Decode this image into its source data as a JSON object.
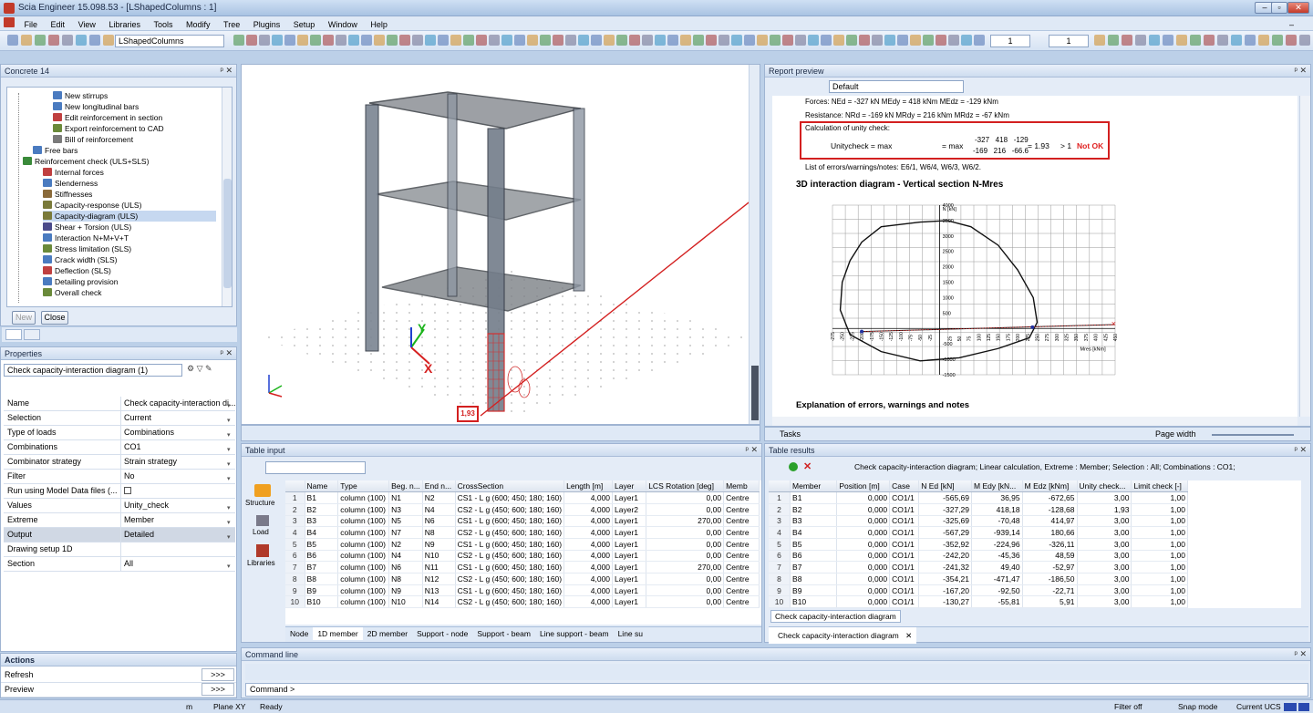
{
  "app": {
    "title": "Scia Engineer 15.098.53 - [LShapedColumns : 1]"
  },
  "menu": [
    "File",
    "Edit",
    "View",
    "Libraries",
    "Tools",
    "Modify",
    "Tree",
    "Plugins",
    "Setup",
    "Window",
    "Help"
  ],
  "toolbar": {
    "project_combo": "LShapedColumns",
    "spin1": "1",
    "spin2": "1"
  },
  "left_tree": {
    "title": "Concrete 14",
    "items": [
      {
        "label": "New stirrups",
        "indent": 4,
        "color": "#4a7bc0"
      },
      {
        "label": "New longitudinal bars",
        "indent": 4,
        "color": "#4a7bc0"
      },
      {
        "label": "Edit reinforcement in section",
        "indent": 4,
        "color": "#c04040"
      },
      {
        "label": "Export reinforcement to CAD",
        "indent": 4,
        "color": "#6a8a3a"
      },
      {
        "label": "Bill of reinforcement",
        "indent": 4,
        "color": "#7a7a7a"
      },
      {
        "label": "Free bars",
        "indent": 2,
        "color": "#4a7bc0"
      },
      {
        "label": "Reinforcement check (ULS+SLS)",
        "indent": 1,
        "color": "#3a8a3a"
      },
      {
        "label": "Internal forces",
        "indent": 3,
        "color": "#c04040"
      },
      {
        "label": "Slenderness",
        "indent": 3,
        "color": "#4a7bc0"
      },
      {
        "label": "Stiffnesses",
        "indent": 3,
        "color": "#8a6a3a"
      },
      {
        "label": "Capacity-response (ULS)",
        "indent": 3,
        "color": "#7a7a3a"
      },
      {
        "label": "Capacity-diagram (ULS)",
        "indent": 3,
        "color": "#7a7a3a",
        "selected": true
      },
      {
        "label": "Shear + Torsion (ULS)",
        "indent": 3,
        "color": "#4a4a8a"
      },
      {
        "label": "Interaction N+M+V+T",
        "indent": 3,
        "color": "#4a7bc0"
      },
      {
        "label": "Stress limitation (SLS)",
        "indent": 3,
        "color": "#6a8a3a"
      },
      {
        "label": "Crack width (SLS)",
        "indent": 3,
        "color": "#4a7bc0"
      },
      {
        "label": "Deflection (SLS)",
        "indent": 3,
        "color": "#c04040"
      },
      {
        "label": "Detailing provision",
        "indent": 3,
        "color": "#4a7bc0"
      },
      {
        "label": "Overall check",
        "indent": 3,
        "color": "#6a8a3a"
      }
    ],
    "new_btn": "New",
    "close_btn": "Close"
  },
  "properties": {
    "title": "Properties",
    "selector": "Check capacity-interaction diagram (1)",
    "rows": [
      {
        "k": "Name",
        "v": "Check capacity-interaction di..."
      },
      {
        "k": "Selection",
        "v": "Current"
      },
      {
        "k": "Type of loads",
        "v": "Combinations"
      },
      {
        "k": "Combinations",
        "v": "CO1"
      },
      {
        "k": "Combinator strategy",
        "v": "Strain strategy"
      },
      {
        "k": "Filter",
        "v": "No"
      },
      {
        "k": "Run using Model Data files (...",
        "v": ""
      },
      {
        "k": "Values",
        "v": "Unity_check"
      },
      {
        "k": "Extreme",
        "v": "Member"
      },
      {
        "k": "Output",
        "v": "Detailed"
      },
      {
        "k": "Drawing setup 1D",
        "v": ""
      },
      {
        "k": "Section",
        "v": "All"
      }
    ]
  },
  "actions": {
    "title": "Actions",
    "items": [
      {
        "label": "Refresh",
        "arrow": ">>>"
      },
      {
        "label": "Preview",
        "arrow": ">>>"
      }
    ]
  },
  "view": {
    "unity_label": "1,93"
  },
  "report": {
    "title": "Report preview",
    "combo": "Default",
    "forces": "Forces:  NEd = -327 kN  MEdy = 418 kNm  MEdz = -129 kNm",
    "resistance": "Resistance:  NRd = -169 kN  MRdy = 216 kNm  MRdz = -67 kNm",
    "calc_title": "Calculation of unity check:",
    "unity_left": "Unitycheck = max",
    "unity_mid": "= max",
    "unity_vals": "-327   418   -129",
    "unity_den": "-169   216   -66.6",
    "unity_res": "= 1.93",
    "unity_cmp": "> 1",
    "unity_status": "Not OK",
    "errors": "List of errors/warnings/notes:  E6/1, W6/4, W6/3, W6/2.",
    "diagram_title": "3D interaction diagram - Vertical section N-Mres",
    "y_axis_label": "N [kN]",
    "x_axis_label": "Mres [kNm]",
    "y_ticks": [
      "4000",
      "3500",
      "3000",
      "2500",
      "2000",
      "1500",
      "1000",
      "500",
      "-500",
      "-1000",
      "-1500"
    ],
    "x_ticks": [
      "-275",
      "-250",
      "-225",
      "-200",
      "-175",
      "-150",
      "-125",
      "-100",
      "-75",
      "-50",
      "-25",
      "25",
      "50",
      "75",
      "100",
      "125",
      "150",
      "175",
      "200",
      "225",
      "250",
      "275",
      "300",
      "325",
      "350",
      "375",
      "400",
      "425",
      "450"
    ],
    "explanation": "Explanation of errors, warnings and notes",
    "page_width": "Page width"
  },
  "tasks": {
    "title": "Tasks"
  },
  "table_input": {
    "title": "Table input",
    "side": [
      "Structure",
      "Load",
      "Libraries"
    ],
    "headers": [
      "",
      "Name",
      "Type",
      "Beg. n...",
      "End n...",
      "CrossSection",
      "Length [m]",
      "Layer",
      "LCS Rotation [deg]",
      "Memb"
    ],
    "rows": [
      [
        "1",
        "B1",
        "column (100)",
        "N1",
        "N2",
        "CS1 - L g (600; 450; 180; 160)",
        "4,000",
        "Layer1",
        "0,00",
        "Centre"
      ],
      [
        "2",
        "B2",
        "column (100)",
        "N3",
        "N4",
        "CS2 - L g (450; 600; 180; 160)",
        "4,000",
        "Layer2",
        "0,00",
        "Centre"
      ],
      [
        "3",
        "B3",
        "column (100)",
        "N5",
        "N6",
        "CS1 - L g (600; 450; 180; 160)",
        "4,000",
        "Layer1",
        "270,00",
        "Centre"
      ],
      [
        "4",
        "B4",
        "column (100)",
        "N7",
        "N8",
        "CS2 - L g (450; 600; 180; 160)",
        "4,000",
        "Layer1",
        "0,00",
        "Centre"
      ],
      [
        "5",
        "B5",
        "column (100)",
        "N2",
        "N9",
        "CS1 - L g (600; 450; 180; 160)",
        "4,000",
        "Layer1",
        "0,00",
        "Centre"
      ],
      [
        "6",
        "B6",
        "column (100)",
        "N4",
        "N10",
        "CS2 - L g (450; 600; 180; 160)",
        "4,000",
        "Layer1",
        "0,00",
        "Centre"
      ],
      [
        "7",
        "B7",
        "column (100)",
        "N6",
        "N11",
        "CS1 - L g (600; 450; 180; 160)",
        "4,000",
        "Layer1",
        "270,00",
        "Centre"
      ],
      [
        "8",
        "B8",
        "column (100)",
        "N8",
        "N12",
        "CS2 - L g (450; 600; 180; 160)",
        "4,000",
        "Layer1",
        "0,00",
        "Centre"
      ],
      [
        "9",
        "B9",
        "column (100)",
        "N9",
        "N13",
        "CS1 - L g (600; 450; 180; 160)",
        "4,000",
        "Layer1",
        "0,00",
        "Centre"
      ],
      [
        "10",
        "B10",
        "column (100)",
        "N10",
        "N14",
        "CS2 - L g (450; 600; 180; 160)",
        "4,000",
        "Layer1",
        "0,00",
        "Centre"
      ]
    ],
    "tabs": [
      "Node",
      "1D member",
      "2D member",
      "Support - node",
      "Support - beam",
      "Line support - beam",
      "Line su"
    ]
  },
  "table_results": {
    "title": "Table results",
    "caption": "Check capacity-interaction diagram; Linear calculation, Extreme : Member; Selection : All; Combinations : CO1;",
    "headers": [
      "",
      "Member",
      "Position [m]",
      "Case",
      "N Ed [kN]",
      "M Edy [kN...",
      "M Edz [kNm]",
      "Unity check...",
      "Limit check [-]"
    ],
    "rows": [
      [
        "1",
        "B1",
        "0,000",
        "CO1/1",
        "-565,69",
        "36,95",
        "-672,65",
        "3,00",
        "1,00"
      ],
      [
        "2",
        "B2",
        "0,000",
        "CO1/1",
        "-327,29",
        "418,18",
        "-128,68",
        "1,93",
        "1,00"
      ],
      [
        "3",
        "B3",
        "0,000",
        "CO1/1",
        "-325,69",
        "-70,48",
        "414,97",
        "3,00",
        "1,00"
      ],
      [
        "4",
        "B4",
        "0,000",
        "CO1/1",
        "-567,29",
        "-939,14",
        "180,66",
        "3,00",
        "1,00"
      ],
      [
        "5",
        "B5",
        "0,000",
        "CO1/1",
        "-352,92",
        "-224,96",
        "-326,11",
        "3,00",
        "1,00"
      ],
      [
        "6",
        "B6",
        "0,000",
        "CO1/1",
        "-242,20",
        "-45,36",
        "48,59",
        "3,00",
        "1,00"
      ],
      [
        "7",
        "B7",
        "0,000",
        "CO1/1",
        "-241,32",
        "49,40",
        "-52,97",
        "3,00",
        "1,00"
      ],
      [
        "8",
        "B8",
        "0,000",
        "CO1/1",
        "-354,21",
        "-471,47",
        "-186,50",
        "3,00",
        "1,00"
      ],
      [
        "9",
        "B9",
        "0,000",
        "CO1/1",
        "-167,20",
        "-92,50",
        "-22,71",
        "3,00",
        "1,00"
      ],
      [
        "10",
        "B10",
        "0,000",
        "CO1/1",
        "-130,27",
        "-55,81",
        "5,91",
        "3,00",
        "1,00"
      ]
    ],
    "subtab": "Check capacity-interaction diagram",
    "bottom_tab": "Check capacity-interaction diagram"
  },
  "command": {
    "title": "Command line",
    "prompt": "Command >"
  },
  "status": {
    "unit": "m",
    "plane": "Plane XY",
    "ready": "Ready",
    "filter": "Filter off",
    "snap": "Snap mode",
    "ucs": "Current UCS"
  }
}
